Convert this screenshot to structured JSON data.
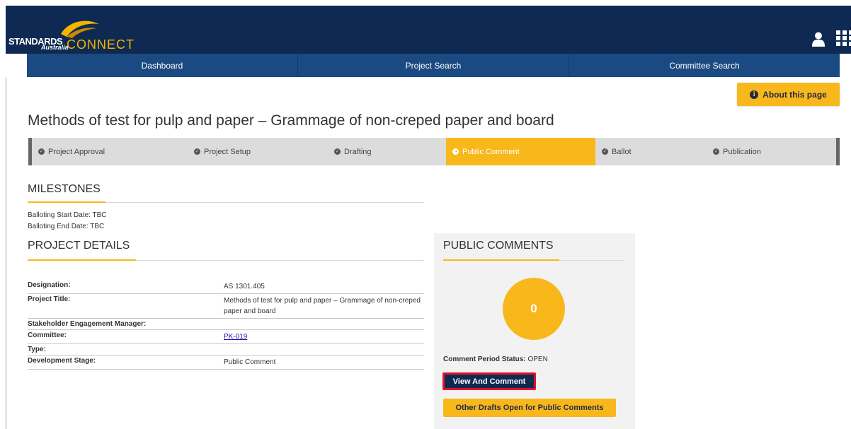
{
  "brand": {
    "line1": "STANDARDS",
    "line2": "Australia",
    "connect": "CONNECT"
  },
  "nav": [
    "Dashboard",
    "Project Search",
    "Committee Search"
  ],
  "about_label": "About this page",
  "page_title": "Methods of test for pulp and paper – Grammage of non-creped paper and board",
  "steps": [
    "Project Approval",
    "Project Setup",
    "Drafting",
    "Public Comment",
    "Ballot",
    "Publication"
  ],
  "active_step": "Public Comment",
  "milestones": {
    "heading": "MILESTONES",
    "lines": [
      "Balloting Start Date: TBC",
      "Balloting End Date: TBC"
    ]
  },
  "project_details": {
    "heading": "PROJECT DETAILS",
    "rows": [
      {
        "label": "Designation:",
        "value": "AS 1301.405"
      },
      {
        "label": "Project Title:",
        "value": "Methods of test for pulp and paper – Grammage of non-creped paper and board"
      },
      {
        "label": "Stakeholder Engagement Manager:",
        "value": ""
      },
      {
        "label": "Committee:",
        "value": "PK-019"
      },
      {
        "label": "Type:",
        "value": ""
      },
      {
        "label": "Development Stage:",
        "value": "Public Comment"
      }
    ]
  },
  "public_comments": {
    "heading": "PUBLIC COMMENTS",
    "count": "0",
    "status_label": "Comment Period Status:",
    "status_value": "OPEN",
    "view_button": "View And Comment",
    "other_button": "Other Drafts Open for Public Comments"
  },
  "colors": {
    "header": "#0e2a52",
    "nav": "#1b4a82",
    "accent": "#f8b81c",
    "highlight_border": "#e0142b"
  }
}
